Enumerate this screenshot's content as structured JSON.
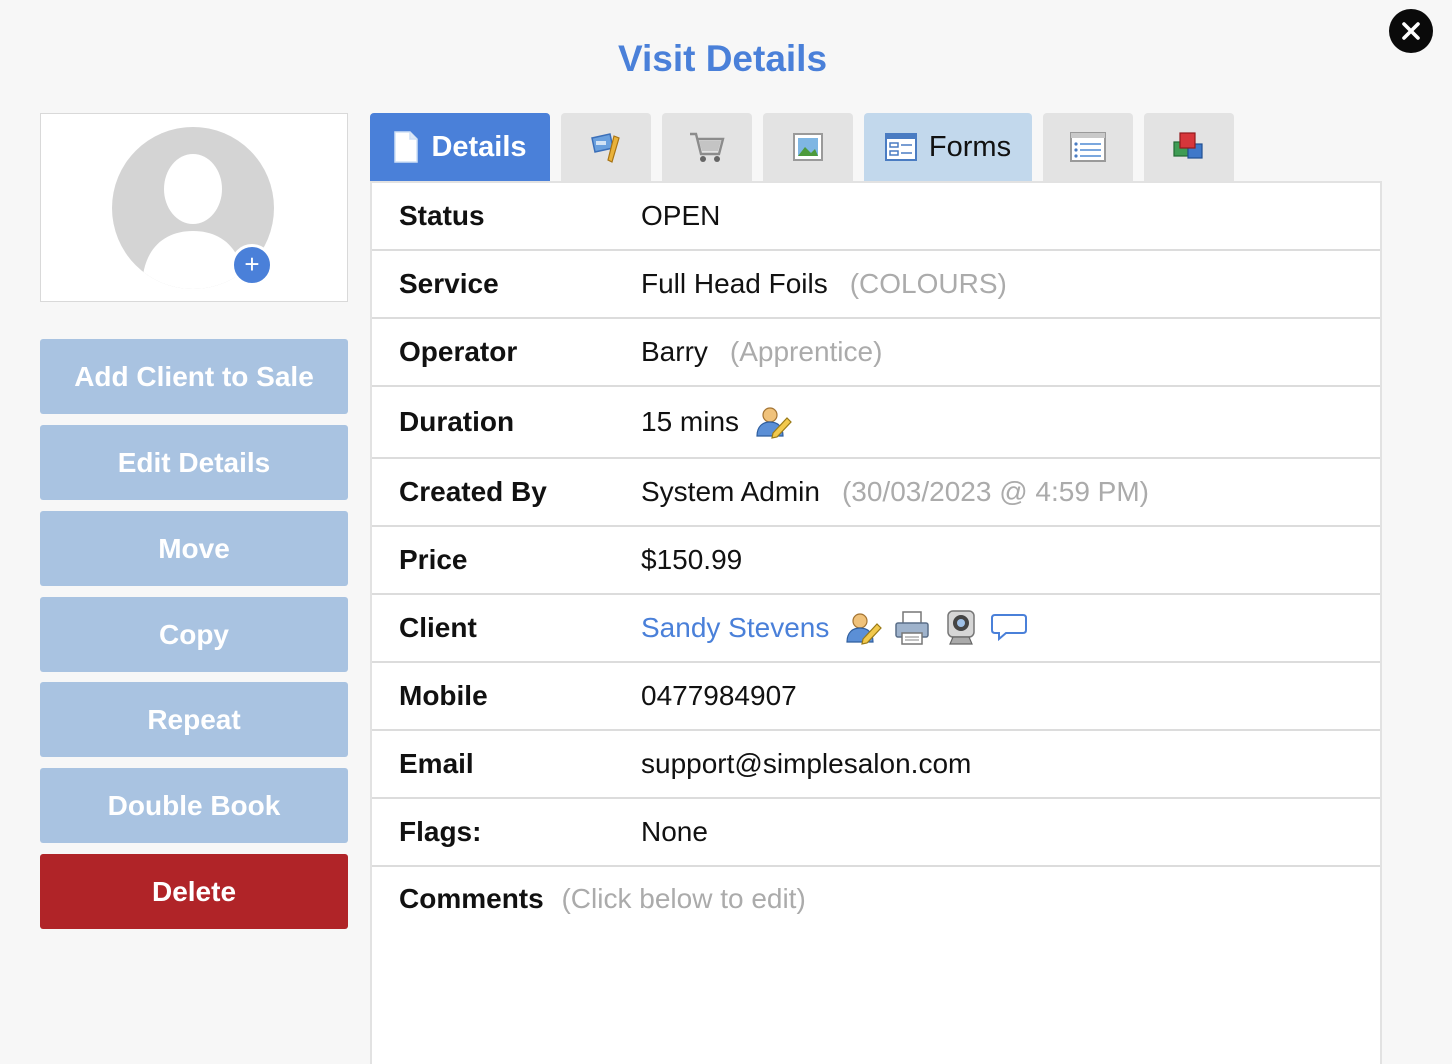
{
  "header": {
    "title": "Visit Details"
  },
  "avatar": {
    "add_symbol": "+"
  },
  "actions": {
    "add_client": "Add Client to Sale",
    "edit_details": "Edit Details",
    "move": "Move",
    "copy": "Copy",
    "repeat": "Repeat",
    "double_book": "Double Book",
    "delete": "Delete"
  },
  "tabs": {
    "details": "Details",
    "forms": "Forms",
    "icons": [
      "document-icon",
      "brush-icon",
      "cart-icon",
      "picture-icon",
      "form-icon",
      "list-icon",
      "cubes-icon"
    ]
  },
  "details": {
    "status_label": "Status",
    "status_value": "OPEN",
    "service_label": "Service",
    "service_value": "Full Head Foils",
    "service_category": "(COLOURS)",
    "operator_label": "Operator",
    "operator_value": "Barry",
    "operator_role": "(Apprentice)",
    "duration_label": "Duration",
    "duration_value": "15 mins",
    "created_label": "Created By",
    "created_value": "System Admin",
    "created_time": "(30/03/2023 @ 4:59 PM)",
    "price_label": "Price",
    "price_value": "$150.99",
    "client_label": "Client",
    "client_value": "Sandy Stevens",
    "mobile_label": "Mobile",
    "mobile_value": "0477984907",
    "email_label": "Email",
    "email_value": "support@simplesalon.com",
    "flags_label": "Flags:",
    "flags_value": "None",
    "comments_label": "Comments",
    "comments_hint": "(Click below to edit)"
  },
  "colors": {
    "accent": "#4a80d9",
    "button": "#a9c3e1",
    "delete": "#b02428",
    "muted": "#ababab"
  }
}
